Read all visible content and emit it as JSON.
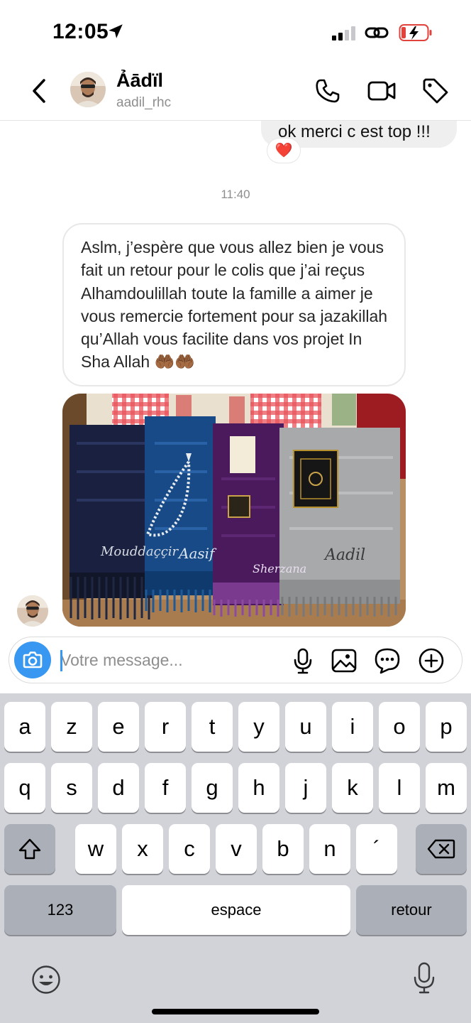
{
  "status_bar": {
    "time": "12:05"
  },
  "header": {
    "contact_name": "Ảādïl",
    "contact_handle": "aadil_rhc"
  },
  "chat": {
    "outgoing_message": "ok merci c est top !!!",
    "reaction": "❤️",
    "timestamp": "11:40",
    "incoming_message": "Aslm, j’espère que vous allez bien je vous fait un retour pour le colis que j’ai reçus Alhamdoulillah toute la famille a aimer je vous remercie fortement pour sa jazakillah qu’Allah vous facilite dans vos projet In Sha Allah 🤲🏾🤲🏾",
    "photo_names": [
      "Mouddaççir",
      "Aasif",
      "Sherzana",
      "Aadil"
    ]
  },
  "composer": {
    "placeholder": "Votre message..."
  },
  "keyboard": {
    "row1": [
      "a",
      "z",
      "e",
      "r",
      "t",
      "y",
      "u",
      "i",
      "o",
      "p"
    ],
    "row2": [
      "q",
      "s",
      "d",
      "f",
      "g",
      "h",
      "j",
      "k",
      "l",
      "m"
    ],
    "row3": [
      "w",
      "x",
      "c",
      "v",
      "b",
      "n",
      "´"
    ],
    "numbers_label": "123",
    "space_label": "espace",
    "return_label": "retour"
  },
  "icons": {
    "back": "chevron-left-icon",
    "call": "phone-icon",
    "video": "video-camera-icon",
    "tag": "tag-icon",
    "camera": "camera-icon",
    "mic": "microphone-icon",
    "gallery": "image-icon",
    "sticker": "sticker-icon",
    "more": "plus-circle-icon",
    "shift": "shift-icon",
    "delete": "backspace-icon",
    "emoji": "emoji-icon",
    "dictation": "dictation-icon"
  },
  "colors": {
    "accent": "#3897f0",
    "bubble_out": "#efefef",
    "keyboard_bg": "#d1d3d9"
  }
}
